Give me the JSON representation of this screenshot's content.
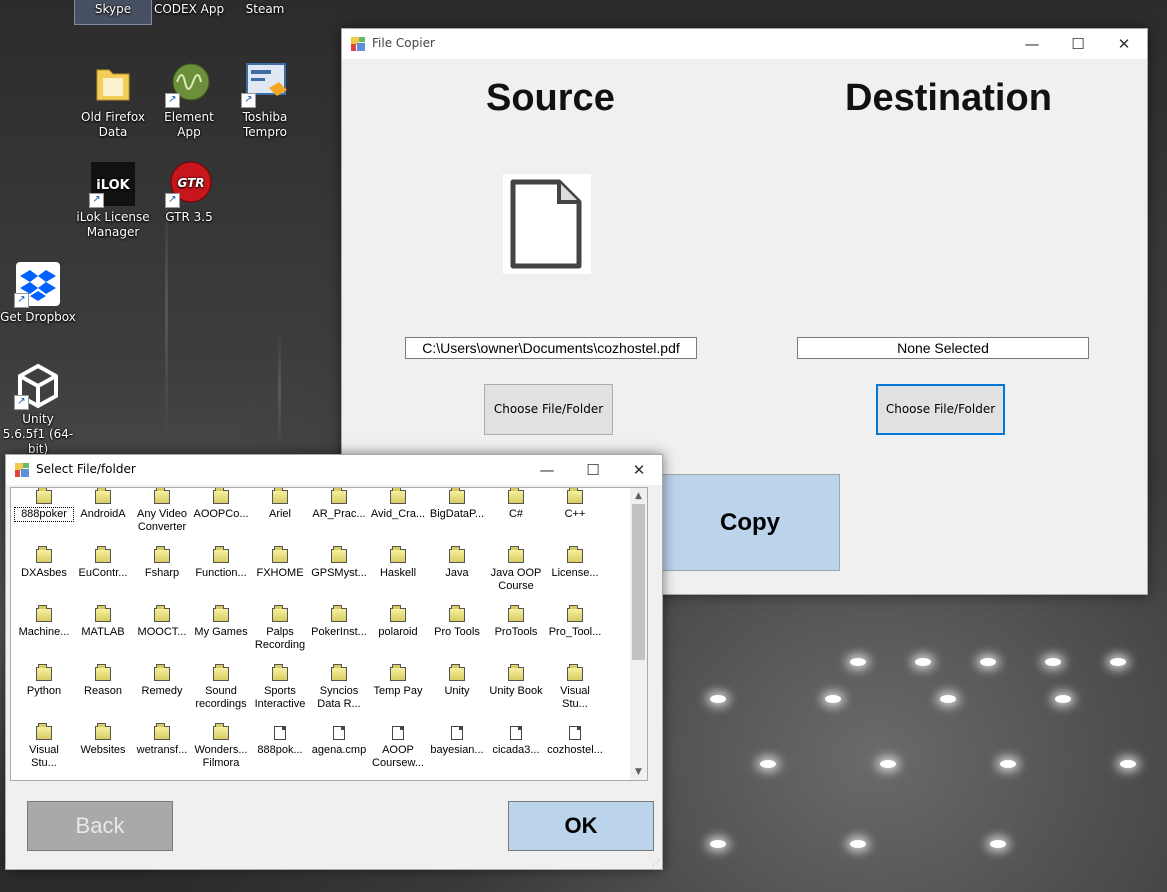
{
  "desktop": {
    "icons": [
      {
        "label": "Skype"
      },
      {
        "label": "CODEX App"
      },
      {
        "label": "Steam"
      },
      {
        "label": "Old Firefox Data"
      },
      {
        "label": "Element App"
      },
      {
        "label": "Toshiba Tempro"
      },
      {
        "label": "iLok License Manager"
      },
      {
        "label": "GTR 3.5"
      },
      {
        "label": "Get Dropbox"
      },
      {
        "label": "Unity 5.6.5f1 (64-bit)"
      }
    ]
  },
  "copier": {
    "title": "File Copier",
    "source_heading": "Source",
    "destination_heading": "Destination",
    "source_path": "C:\\Users\\owner\\Documents\\cozhostel.pdf",
    "destination_path": "None Selected",
    "choose_source_label": "Choose File/Folder",
    "choose_dest_label": "Choose File/Folder",
    "copy_label": "Copy",
    "preview_icon": "document-icon"
  },
  "dialog": {
    "title": "Select File/folder",
    "back_label": "Back",
    "ok_label": "OK",
    "items": [
      {
        "label": "888poker",
        "type": "folder"
      },
      {
        "label": "AndroidA",
        "type": "folder"
      },
      {
        "label": "Any Video Converter",
        "type": "folder"
      },
      {
        "label": "AOOPCo...",
        "type": "folder"
      },
      {
        "label": "Ariel",
        "type": "folder"
      },
      {
        "label": "AR_Prac...",
        "type": "folder"
      },
      {
        "label": "Avid_Cra...",
        "type": "folder"
      },
      {
        "label": "BigDataP...",
        "type": "folder"
      },
      {
        "label": "C#",
        "type": "folder"
      },
      {
        "label": "C++",
        "type": "folder"
      },
      {
        "label": "DXAsbes",
        "type": "folder"
      },
      {
        "label": "EuContr...",
        "type": "folder"
      },
      {
        "label": "Fsharp",
        "type": "folder"
      },
      {
        "label": "Function...",
        "type": "folder"
      },
      {
        "label": "FXHOME",
        "type": "folder"
      },
      {
        "label": "GPSMyst...",
        "type": "folder"
      },
      {
        "label": "Haskell",
        "type": "folder"
      },
      {
        "label": "Java",
        "type": "folder"
      },
      {
        "label": "Java OOP Course",
        "type": "folder"
      },
      {
        "label": "License...",
        "type": "folder"
      },
      {
        "label": "Machine...",
        "type": "folder"
      },
      {
        "label": "MATLAB",
        "type": "folder"
      },
      {
        "label": "MOOCT...",
        "type": "folder"
      },
      {
        "label": "My Games",
        "type": "folder"
      },
      {
        "label": "Palps Recording",
        "type": "folder"
      },
      {
        "label": "PokerInst...",
        "type": "folder"
      },
      {
        "label": "polaroid",
        "type": "folder"
      },
      {
        "label": "Pro Tools",
        "type": "folder"
      },
      {
        "label": "ProTools",
        "type": "folder"
      },
      {
        "label": "Pro_Tool...",
        "type": "folder"
      },
      {
        "label": "Python",
        "type": "folder"
      },
      {
        "label": "Reason",
        "type": "folder"
      },
      {
        "label": "Remedy",
        "type": "folder"
      },
      {
        "label": "Sound recordings",
        "type": "folder"
      },
      {
        "label": "Sports Interactive",
        "type": "folder"
      },
      {
        "label": "Syncios Data R...",
        "type": "folder"
      },
      {
        "label": "Temp Pay",
        "type": "folder"
      },
      {
        "label": "Unity",
        "type": "folder"
      },
      {
        "label": "Unity Book",
        "type": "folder"
      },
      {
        "label": "Visual Stu...",
        "type": "folder"
      },
      {
        "label": "Visual Stu...",
        "type": "folder"
      },
      {
        "label": "Websites",
        "type": "folder"
      },
      {
        "label": "wetransf...",
        "type": "folder"
      },
      {
        "label": "Wonders... Filmora",
        "type": "folder"
      },
      {
        "label": "888pok...",
        "type": "file"
      },
      {
        "label": "agena.cmp",
        "type": "file"
      },
      {
        "label": "AOOP Coursew...",
        "type": "file"
      },
      {
        "label": "bayesian...",
        "type": "file"
      },
      {
        "label": "cicada3...",
        "type": "file"
      },
      {
        "label": "cozhostel...",
        "type": "file"
      }
    ]
  },
  "colors": {
    "copy_button": "#bcd3ec",
    "ok_button": "#bcd3ec",
    "back_button": "#a9a9a9",
    "focus_border": "#0078d7",
    "folder": "#e8dd7a"
  }
}
